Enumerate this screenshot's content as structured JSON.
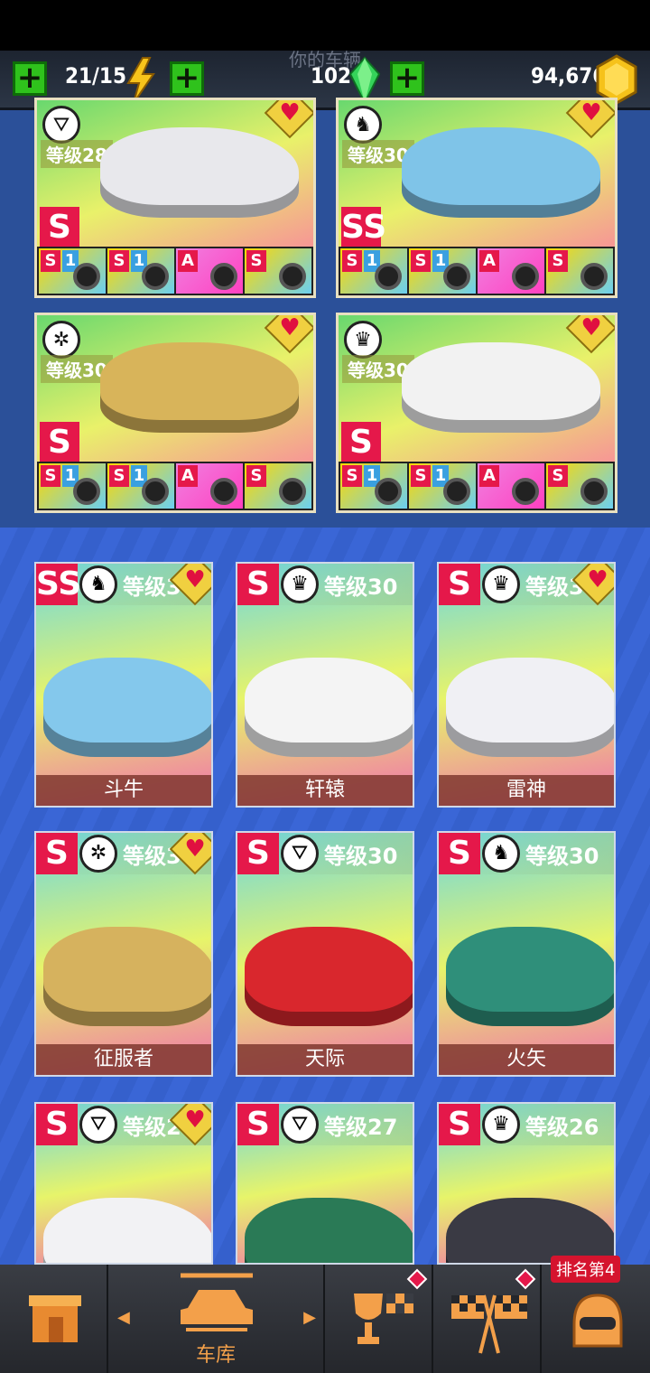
{
  "topbar": {
    "title": "你的车辆",
    "fuel": "21/15",
    "gems": "102",
    "coins": "94,676"
  },
  "garage_cards": [
    {
      "level": "等级28",
      "grade": "S",
      "emblem": "road-emblem",
      "favorite": true,
      "car_color": "#e8e8ec",
      "parts": [
        {
          "grade": "S",
          "num": "1",
          "kind": "turbo"
        },
        {
          "grade": "S",
          "num": "1",
          "kind": "engine"
        },
        {
          "grade": "A",
          "num": "",
          "kind": "suspension"
        },
        {
          "grade": "S",
          "num": "",
          "kind": "tire"
        }
      ]
    },
    {
      "level": "等级30",
      "grade": "SS",
      "emblem": "horse-emblem",
      "favorite": true,
      "car_color": "#7fc4e8",
      "parts": [
        {
          "grade": "S",
          "num": "1",
          "kind": "turbo"
        },
        {
          "grade": "S",
          "num": "1",
          "kind": "engine"
        },
        {
          "grade": "A",
          "num": "",
          "kind": "suspension"
        },
        {
          "grade": "S",
          "num": "",
          "kind": "tire"
        }
      ]
    },
    {
      "level": "等级30",
      "grade": "S",
      "emblem": "wheel-emblem",
      "favorite": true,
      "car_color": "#d8b45a",
      "parts": [
        {
          "grade": "S",
          "num": "1",
          "kind": "turbo"
        },
        {
          "grade": "S",
          "num": "1",
          "kind": "engine"
        },
        {
          "grade": "A",
          "num": "",
          "kind": "suspension"
        },
        {
          "grade": "S",
          "num": "",
          "kind": "tire"
        }
      ]
    },
    {
      "level": "等级30",
      "grade": "S",
      "emblem": "crown-emblem",
      "favorite": true,
      "car_color": "#f2f2f2",
      "parts": [
        {
          "grade": "S",
          "num": "1",
          "kind": "turbo"
        },
        {
          "grade": "S",
          "num": "1",
          "kind": "engine"
        },
        {
          "grade": "A",
          "num": "",
          "kind": "suspension"
        },
        {
          "grade": "S",
          "num": "",
          "kind": "tire"
        }
      ]
    }
  ],
  "cars": [
    {
      "grade": "SS",
      "level": "等级3",
      "name": "斗牛",
      "emblem": "♞",
      "favorite": true,
      "color": "#84c8ec"
    },
    {
      "grade": "S",
      "level": "等级30",
      "name": "轩辕",
      "emblem": "♛",
      "favorite": false,
      "color": "#f4f4f4"
    },
    {
      "grade": "S",
      "level": "等级3",
      "name": "雷神",
      "emblem": "♛",
      "favorite": true,
      "color": "#f0f0f4"
    },
    {
      "grade": "S",
      "level": "等级3",
      "name": "征服者",
      "emblem": "✲",
      "favorite": true,
      "color": "#d6b25e"
    },
    {
      "grade": "S",
      "level": "等级30",
      "name": "天际",
      "emblem": "⛛",
      "favorite": false,
      "color": "#d9272d"
    },
    {
      "grade": "S",
      "level": "等级30",
      "name": "火矢",
      "emblem": "♞",
      "favorite": false,
      "color": "#2f8f7a"
    },
    {
      "grade": "S",
      "level": "等级2",
      "name": "",
      "emblem": "⛛",
      "favorite": true,
      "color": "#f2f2f4"
    },
    {
      "grade": "S",
      "level": "等级27",
      "name": "",
      "emblem": "⛛",
      "favorite": false,
      "color": "#2a7a56"
    },
    {
      "grade": "S",
      "level": "等级26",
      "name": "",
      "emblem": "♛",
      "favorite": false,
      "color": "#3a3a44"
    }
  ],
  "bottom_nav": {
    "garage_label": "车库",
    "rank_label": "排名第4"
  },
  "colors": {
    "grade_red": "#e5184a",
    "accent_orange": "#f3a04a",
    "plus_green": "#2fc21c"
  }
}
